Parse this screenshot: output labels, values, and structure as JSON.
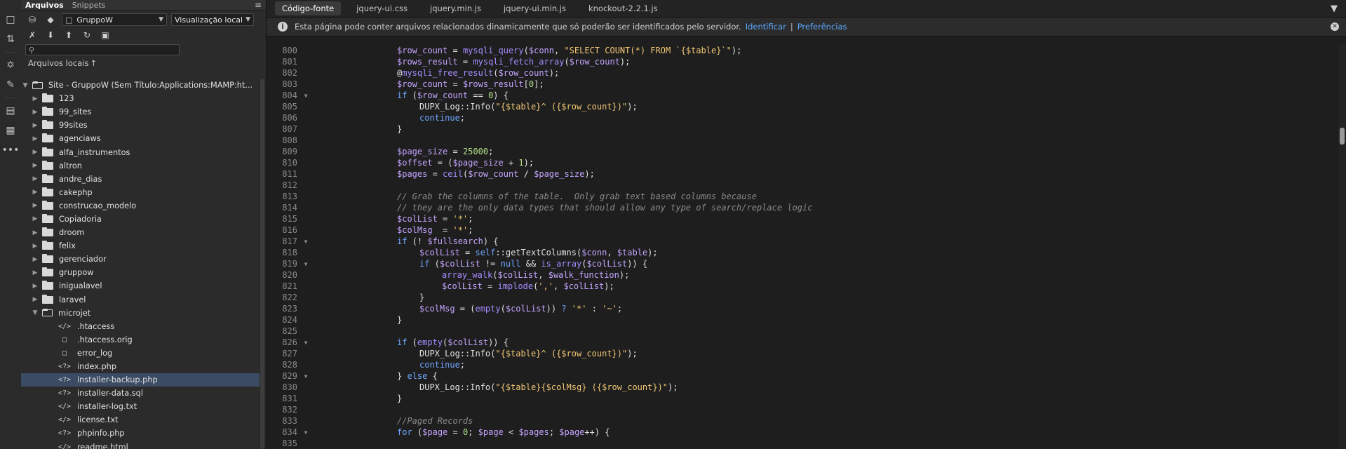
{
  "panel": {
    "tabs": [
      "Arquivos",
      "Snippets"
    ],
    "site_select": "GruppoW",
    "view_select": "Visualização local",
    "search_placeholder": "",
    "local_files_label": "Arquivos locais",
    "site_root": "Site - GruppoW (Sem Título:Applications:MAMP:ht...",
    "folders": [
      "123",
      "99_sites",
      "99sites",
      "agenciaws",
      "alfa_instrumentos",
      "altron",
      "andre_dias",
      "cakephp",
      "construcao_modelo",
      "Copiadoria",
      "droom",
      "felix",
      "gerenciador",
      "gruppow",
      "inigualavel",
      "laravel"
    ],
    "open_folder": "microjet",
    "files": [
      {
        "name": ".htaccess",
        "icon": "code-file-icon"
      },
      {
        "name": ".htaccess.orig",
        "icon": "file-icon"
      },
      {
        "name": "error_log",
        "icon": "file-icon"
      },
      {
        "name": "index.php",
        "icon": "php-file-icon"
      },
      {
        "name": "installer-backup.php",
        "icon": "php-file-icon",
        "selected": true
      },
      {
        "name": "installer-data.sql",
        "icon": "php-file-icon"
      },
      {
        "name": "installer-log.txt",
        "icon": "code-file-icon"
      },
      {
        "name": "license.txt",
        "icon": "code-file-icon"
      },
      {
        "name": "phpinfo.php",
        "icon": "php-file-icon"
      },
      {
        "name": "readme.html",
        "icon": "code-file-icon"
      }
    ]
  },
  "editor": {
    "tabs": [
      "Código-fonte",
      "jquery-ui.css",
      "jquery.min.js",
      "jquery-ui.min.js",
      "knockout-2.2.1.js"
    ],
    "info_text": "Esta página pode conter arquivos relacionados dinamicamente que só poderão ser identificados pelo servidor.",
    "info_link1": "Identificar",
    "info_sep": "|",
    "info_link2": "Preferências",
    "lines": [
      {
        "n": "800",
        "fold": false,
        "indent": 0,
        "code": [
          [
            "var",
            "$row_count"
          ],
          [
            "op",
            " = "
          ],
          [
            "fn",
            "mysqli_query"
          ],
          [
            "op",
            "("
          ],
          [
            "var",
            "$conn"
          ],
          [
            "op",
            ", "
          ],
          [
            "str",
            "\"SELECT COUNT(*) FROM `{$table}`\""
          ],
          [
            "op",
            ");"
          ]
        ]
      },
      {
        "n": "801",
        "fold": false,
        "indent": 0,
        "code": [
          [
            "var",
            "$rows_result"
          ],
          [
            "op",
            " = "
          ],
          [
            "fn",
            "mysqli_fetch_array"
          ],
          [
            "op",
            "("
          ],
          [
            "var",
            "$row_count"
          ],
          [
            "op",
            ");"
          ]
        ]
      },
      {
        "n": "802",
        "fold": false,
        "indent": 0,
        "code": [
          [
            "op",
            "@"
          ],
          [
            "fn",
            "mysqli_free_result"
          ],
          [
            "op",
            "("
          ],
          [
            "var",
            "$row_count"
          ],
          [
            "op",
            ");"
          ]
        ]
      },
      {
        "n": "803",
        "fold": false,
        "indent": 0,
        "code": [
          [
            "var",
            "$row_count"
          ],
          [
            "op",
            " = "
          ],
          [
            "var",
            "$rows_result"
          ],
          [
            "op",
            "["
          ],
          [
            "num",
            "0"
          ],
          [
            "op",
            "];"
          ]
        ]
      },
      {
        "n": "804",
        "fold": true,
        "indent": 0,
        "code": [
          [
            "kw",
            "if"
          ],
          [
            "op",
            " ("
          ],
          [
            "var",
            "$row_count"
          ],
          [
            "op",
            " == "
          ],
          [
            "num",
            "0"
          ],
          [
            "op",
            ") {"
          ]
        ]
      },
      {
        "n": "805",
        "fold": false,
        "indent": 1,
        "code": [
          [
            "op",
            "DUPX_Log::Info("
          ],
          [
            "str",
            "\"{$table}^ ({$row_count})\""
          ],
          [
            "op",
            ");"
          ]
        ]
      },
      {
        "n": "806",
        "fold": false,
        "indent": 1,
        "code": [
          [
            "kw",
            "continue"
          ],
          [
            "op",
            ";"
          ]
        ]
      },
      {
        "n": "807",
        "fold": false,
        "indent": 0,
        "code": [
          [
            "op",
            "}"
          ]
        ]
      },
      {
        "n": "808",
        "fold": false,
        "indent": 0,
        "code": []
      },
      {
        "n": "809",
        "fold": false,
        "indent": 0,
        "code": [
          [
            "var",
            "$page_size"
          ],
          [
            "op",
            " = "
          ],
          [
            "num",
            "25000"
          ],
          [
            "op",
            ";"
          ]
        ]
      },
      {
        "n": "810",
        "fold": false,
        "indent": 0,
        "code": [
          [
            "var",
            "$offset"
          ],
          [
            "op",
            " = ("
          ],
          [
            "var",
            "$page_size"
          ],
          [
            "op",
            " + "
          ],
          [
            "num",
            "1"
          ],
          [
            "op",
            ");"
          ]
        ]
      },
      {
        "n": "811",
        "fold": false,
        "indent": 0,
        "code": [
          [
            "var",
            "$pages"
          ],
          [
            "op",
            " = "
          ],
          [
            "fn",
            "ceil"
          ],
          [
            "op",
            "("
          ],
          [
            "var",
            "$row_count"
          ],
          [
            "op",
            " / "
          ],
          [
            "var",
            "$page_size"
          ],
          [
            "op",
            ");"
          ]
        ]
      },
      {
        "n": "812",
        "fold": false,
        "indent": 0,
        "code": []
      },
      {
        "n": "813",
        "fold": false,
        "indent": 0,
        "code": [
          [
            "com",
            "// Grab the columns of the table.  Only grab text based columns because"
          ]
        ]
      },
      {
        "n": "814",
        "fold": false,
        "indent": 0,
        "code": [
          [
            "com",
            "// they are the only data types that should allow any type of search/replace logic"
          ]
        ]
      },
      {
        "n": "815",
        "fold": false,
        "indent": 0,
        "code": [
          [
            "var",
            "$colList"
          ],
          [
            "op",
            " = "
          ],
          [
            "str",
            "'*'"
          ],
          [
            "op",
            ";"
          ]
        ]
      },
      {
        "n": "816",
        "fold": false,
        "indent": 0,
        "code": [
          [
            "var",
            "$colMsg"
          ],
          [
            "op",
            "  = "
          ],
          [
            "str",
            "'*'"
          ],
          [
            "op",
            ";"
          ]
        ]
      },
      {
        "n": "817",
        "fold": true,
        "indent": 0,
        "code": [
          [
            "kw",
            "if"
          ],
          [
            "op",
            " (! "
          ],
          [
            "var",
            "$fullsearch"
          ],
          [
            "op",
            ") {"
          ]
        ]
      },
      {
        "n": "818",
        "fold": false,
        "indent": 1,
        "code": [
          [
            "var",
            "$colList"
          ],
          [
            "op",
            " = "
          ],
          [
            "kw",
            "self"
          ],
          [
            "op",
            "::getTextColumns("
          ],
          [
            "var",
            "$conn"
          ],
          [
            "op",
            ", "
          ],
          [
            "var",
            "$table"
          ],
          [
            "op",
            ");"
          ]
        ]
      },
      {
        "n": "819",
        "fold": true,
        "indent": 1,
        "code": [
          [
            "kw",
            "if"
          ],
          [
            "op",
            " ("
          ],
          [
            "var",
            "$colList"
          ],
          [
            "op",
            " != "
          ],
          [
            "kw",
            "null"
          ],
          [
            "op",
            " && "
          ],
          [
            "fn",
            "is_array"
          ],
          [
            "op",
            "("
          ],
          [
            "var",
            "$colList"
          ],
          [
            "op",
            ")) {"
          ]
        ]
      },
      {
        "n": "820",
        "fold": false,
        "indent": 2,
        "code": [
          [
            "fn",
            "array_walk"
          ],
          [
            "op",
            "("
          ],
          [
            "var",
            "$colList"
          ],
          [
            "op",
            ", "
          ],
          [
            "var",
            "$walk_function"
          ],
          [
            "op",
            ");"
          ]
        ]
      },
      {
        "n": "821",
        "fold": false,
        "indent": 2,
        "code": [
          [
            "var",
            "$colList"
          ],
          [
            "op",
            " = "
          ],
          [
            "fn",
            "implode"
          ],
          [
            "op",
            "("
          ],
          [
            "str",
            "','"
          ],
          [
            "op",
            ", "
          ],
          [
            "var",
            "$colList"
          ],
          [
            "op",
            ");"
          ]
        ]
      },
      {
        "n": "822",
        "fold": false,
        "indent": 1,
        "code": [
          [
            "op",
            "}"
          ]
        ]
      },
      {
        "n": "823",
        "fold": false,
        "indent": 1,
        "code": [
          [
            "var",
            "$colMsg"
          ],
          [
            "op",
            " = ("
          ],
          [
            "fn",
            "empty"
          ],
          [
            "op",
            "("
          ],
          [
            "var",
            "$colList"
          ],
          [
            "op",
            ")) "
          ],
          [
            "kw",
            "?"
          ],
          [
            "op",
            " "
          ],
          [
            "str",
            "'*'"
          ],
          [
            "op",
            " : "
          ],
          [
            "str",
            "'~'"
          ],
          [
            "op",
            ";"
          ]
        ]
      },
      {
        "n": "824",
        "fold": false,
        "indent": 0,
        "code": [
          [
            "op",
            "}"
          ]
        ]
      },
      {
        "n": "825",
        "fold": false,
        "indent": 0,
        "code": []
      },
      {
        "n": "826",
        "fold": true,
        "indent": 0,
        "code": [
          [
            "kw",
            "if"
          ],
          [
            "op",
            " ("
          ],
          [
            "fn",
            "empty"
          ],
          [
            "op",
            "("
          ],
          [
            "var",
            "$colList"
          ],
          [
            "op",
            ")) {"
          ]
        ]
      },
      {
        "n": "827",
        "fold": false,
        "indent": 1,
        "code": [
          [
            "op",
            "DUPX_Log::Info("
          ],
          [
            "str",
            "\"{$table}^ ({$row_count})\""
          ],
          [
            "op",
            ");"
          ]
        ]
      },
      {
        "n": "828",
        "fold": false,
        "indent": 1,
        "code": [
          [
            "kw",
            "continue"
          ],
          [
            "op",
            ";"
          ]
        ]
      },
      {
        "n": "829",
        "fold": true,
        "indent": 0,
        "code": [
          [
            "op",
            "} "
          ],
          [
            "kw",
            "else"
          ],
          [
            "op",
            " {"
          ]
        ]
      },
      {
        "n": "830",
        "fold": false,
        "indent": 1,
        "code": [
          [
            "op",
            "DUPX_Log::Info("
          ],
          [
            "str",
            "\"{$table}{$colMsg} ({$row_count})\""
          ],
          [
            "op",
            ");"
          ]
        ]
      },
      {
        "n": "831",
        "fold": false,
        "indent": 0,
        "code": [
          [
            "op",
            "}"
          ]
        ]
      },
      {
        "n": "832",
        "fold": false,
        "indent": 0,
        "code": []
      },
      {
        "n": "833",
        "fold": false,
        "indent": 0,
        "code": [
          [
            "com",
            "//Paged Records"
          ]
        ]
      },
      {
        "n": "834",
        "fold": true,
        "indent": 0,
        "code": [
          [
            "kw",
            "for"
          ],
          [
            "op",
            " ("
          ],
          [
            "var",
            "$page"
          ],
          [
            "op",
            " = "
          ],
          [
            "num",
            "0"
          ],
          [
            "op",
            "; "
          ],
          [
            "var",
            "$page"
          ],
          [
            "op",
            " < "
          ],
          [
            "var",
            "$pages"
          ],
          [
            "op",
            "; "
          ],
          [
            "var",
            "$page"
          ],
          [
            "op",
            "++) {"
          ]
        ]
      },
      {
        "n": "835",
        "fold": false,
        "indent": 0,
        "code": []
      }
    ]
  }
}
